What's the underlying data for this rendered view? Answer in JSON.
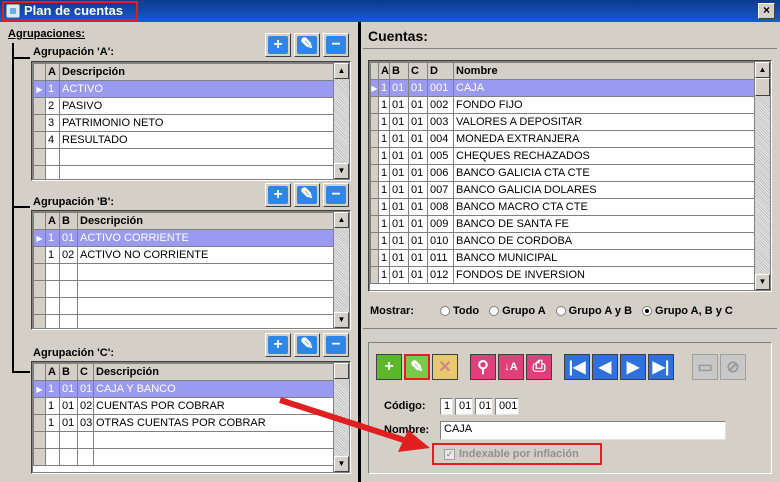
{
  "window": {
    "title": "Plan de cuentas",
    "close_label": "×"
  },
  "left": {
    "agrupaciones_label": "Agrupaciones:",
    "groupA": {
      "title": "Agrupación 'A':",
      "headers": [
        "A",
        "Descripción"
      ],
      "rows": [
        {
          "a": "1",
          "desc": "ACTIVO"
        },
        {
          "a": "2",
          "desc": "PASIVO"
        },
        {
          "a": "3",
          "desc": "PATRIMONIO NETO"
        },
        {
          "a": "4",
          "desc": "RESULTADO"
        }
      ]
    },
    "groupB": {
      "title": "Agrupación 'B':",
      "headers": [
        "A",
        "B",
        "Descripción"
      ],
      "rows": [
        {
          "a": "1",
          "b": "01",
          "desc": "ACTIVO CORRIENTE"
        },
        {
          "a": "1",
          "b": "02",
          "desc": "ACTIVO NO CORRIENTE"
        }
      ]
    },
    "groupC": {
      "title": "Agrupación 'C':",
      "headers": [
        "A",
        "B",
        "C",
        "Descripción"
      ],
      "rows": [
        {
          "a": "1",
          "b": "01",
          "c": "01",
          "desc": "CAJA Y BANCO"
        },
        {
          "a": "1",
          "b": "01",
          "c": "02",
          "desc": "CUENTAS POR COBRAR"
        },
        {
          "a": "1",
          "b": "01",
          "c": "03",
          "desc": "OTRAS CUENTAS POR COBRAR"
        }
      ]
    }
  },
  "right": {
    "title": "Cuentas:",
    "headers": [
      "A",
      "B",
      "C",
      "D",
      "Nombre"
    ],
    "rows": [
      {
        "a": "1",
        "b": "01",
        "c": "01",
        "d": "001",
        "nombre": "CAJA"
      },
      {
        "a": "1",
        "b": "01",
        "c": "01",
        "d": "002",
        "nombre": "FONDO FIJO"
      },
      {
        "a": "1",
        "b": "01",
        "c": "01",
        "d": "003",
        "nombre": "VALORES A DEPOSITAR"
      },
      {
        "a": "1",
        "b": "01",
        "c": "01",
        "d": "004",
        "nombre": "MONEDA EXTRANJERA"
      },
      {
        "a": "1",
        "b": "01",
        "c": "01",
        "d": "005",
        "nombre": "CHEQUES RECHAZADOS"
      },
      {
        "a": "1",
        "b": "01",
        "c": "01",
        "d": "006",
        "nombre": "BANCO GALICIA CTA CTE"
      },
      {
        "a": "1",
        "b": "01",
        "c": "01",
        "d": "007",
        "nombre": "BANCO GALICIA DOLARES"
      },
      {
        "a": "1",
        "b": "01",
        "c": "01",
        "d": "008",
        "nombre": "BANCO MACRO CTA CTE"
      },
      {
        "a": "1",
        "b": "01",
        "c": "01",
        "d": "009",
        "nombre": "BANCO DE SANTA FE"
      },
      {
        "a": "1",
        "b": "01",
        "c": "01",
        "d": "010",
        "nombre": "BANCO DE CORDOBA"
      },
      {
        "a": "1",
        "b": "01",
        "c": "01",
        "d": "011",
        "nombre": "BANCO MUNICIPAL"
      },
      {
        "a": "1",
        "b": "01",
        "c": "01",
        "d": "012",
        "nombre": "FONDOS DE INVERSION"
      }
    ],
    "mostrar": {
      "label": "Mostrar:",
      "options": [
        "Todo",
        "Grupo A",
        "Grupo A y B",
        "Grupo A, B y C"
      ],
      "selected": "Grupo A, B y C"
    },
    "form": {
      "codigo_label": "Código:",
      "codigo": [
        "1",
        "01",
        "01",
        "001"
      ],
      "nombre_label": "Nombre:",
      "nombre_value": "CAJA",
      "indexable_label": "Indexable por inflación",
      "indexable_checked": true
    }
  },
  "colors": {
    "selection": "#9a9af0",
    "titlebar": "#1a5ad0",
    "highlight": "#e02020",
    "toolbar_blue": "#2f86e6"
  }
}
